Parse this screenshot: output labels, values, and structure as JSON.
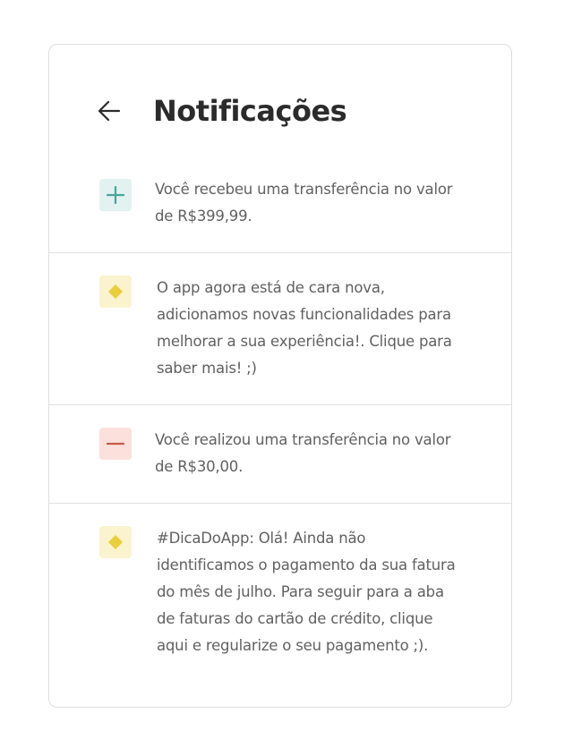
{
  "header": {
    "title": "Notificações"
  },
  "notifications": [
    {
      "icon": "plus-icon",
      "text": "Você recebeu uma transferência no valor de R$399,99."
    },
    {
      "icon": "diamond-icon",
      "text": "O app agora está de cara nova, adicionamos novas funcionalidades para melhorar a sua experiência!. Clique para saber mais! ;)"
    },
    {
      "icon": "minus-icon",
      "text": "Você realizou uma transferência no valor de R$30,00."
    },
    {
      "icon": "diamond-icon",
      "text": "#DicaDoApp: Olá! Ainda não identificamos o pagamento da sua fatura do mês de julho. Para seguir para a aba de faturas do cartão de crédito, clique aqui e regularize o seu pagamento ;)."
    }
  ],
  "colors": {
    "plus_badge_bg": "#e1f2f0",
    "plus_icon": "#4aa39a",
    "minus_badge_bg": "#fce0dc",
    "minus_icon": "#c65a4c",
    "diamond_badge_bg": "#fbf3cd",
    "diamond_icon": "#e8cf3b",
    "title_text": "#2b2b2b",
    "body_text": "#616161"
  }
}
